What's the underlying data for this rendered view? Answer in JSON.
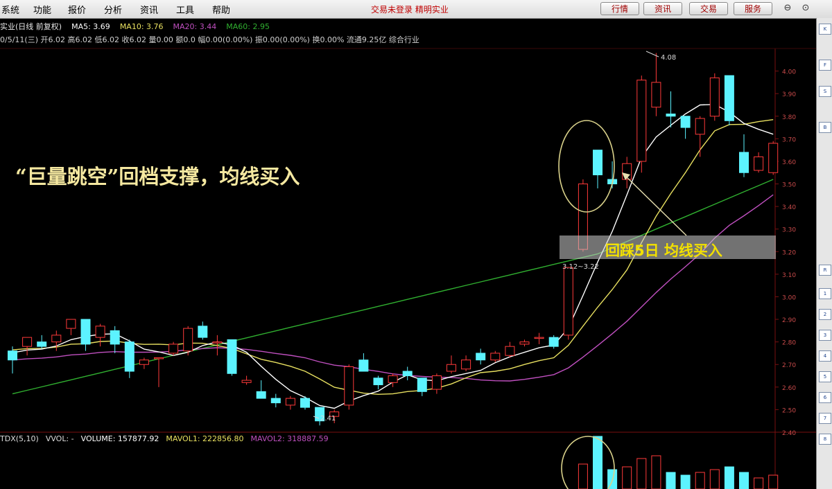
{
  "menubar": {
    "items": [
      "系统",
      "功能",
      "报价",
      "分析",
      "资讯",
      "工具",
      "帮助"
    ],
    "brand": "交易未登录  精明实业",
    "buttons": [
      "行情",
      "资讯",
      "交易",
      "服务"
    ],
    "window_controls": [
      "⊖",
      "⊙"
    ]
  },
  "info": {
    "title": "实业(日线 前复权)",
    "ma5": "MA5: 3.69",
    "ma10": "MA10: 3.76",
    "ma20": "MA20: 3.44",
    "ma60": "MA60: 2.95",
    "ohlc_line": "0/5/11(三) 开6.02 高6.02 低6.02 收6.02 量0.00 额0.0 幅0.00(0.00%) 振0.00(0.00%) 换0.00% 流通9.25亿 综合行业"
  },
  "colors": {
    "up": "#ff3a3a",
    "down": "#5cf3ff",
    "ma5": "#ffffff",
    "ma10": "#e8e060",
    "ma20": "#c050c0",
    "ma60": "#30b030",
    "annotation": "#f5e8a0",
    "highlight_text": "#f2e000"
  },
  "annotations": {
    "main_text": "“巨量跳空”回档支撑，均线买入",
    "callout": "回踩5日 均线买入",
    "gap_label": "3.12~3.22",
    "high_label": "4.08",
    "low_label": "2.41"
  },
  "volume_bar": {
    "indicator": "TDX(5,10)",
    "vvol": "VVOL: -",
    "volume": "VOLUME: 157877.92",
    "mavol1": "MAVOL1: 222856.80",
    "mavol2": "MAVOL2: 318887.59"
  },
  "rightbar_icons": [
    "K",
    "F",
    "S",
    "B",
    "R",
    "1",
    "2",
    "3",
    "4",
    "5",
    "6",
    "7",
    "8"
  ],
  "chart_data": {
    "type": "candlestick",
    "title": "",
    "ylim": [
      2.4,
      4.1
    ],
    "y_ticks": [
      4.0,
      3.9,
      3.8,
      3.7,
      3.6,
      3.5,
      3.4,
      3.3,
      3.2,
      3.1,
      3.0,
      2.9,
      2.8,
      2.7,
      2.6,
      2.5,
      2.4
    ],
    "candles": [
      {
        "o": 2.76,
        "h": 2.78,
        "l": 2.66,
        "c": 2.72
      },
      {
        "o": 2.78,
        "h": 2.82,
        "l": 2.74,
        "c": 2.82
      },
      {
        "o": 2.8,
        "h": 2.83,
        "l": 2.77,
        "c": 2.78
      },
      {
        "o": 2.8,
        "h": 2.85,
        "l": 2.76,
        "c": 2.83
      },
      {
        "o": 2.86,
        "h": 2.9,
        "l": 2.83,
        "c": 2.9
      },
      {
        "o": 2.9,
        "h": 2.9,
        "l": 2.76,
        "c": 2.79
      },
      {
        "o": 2.82,
        "h": 2.88,
        "l": 2.78,
        "c": 2.87
      },
      {
        "o": 2.85,
        "h": 2.87,
        "l": 2.75,
        "c": 2.79
      },
      {
        "o": 2.8,
        "h": 2.81,
        "l": 2.64,
        "c": 2.67
      },
      {
        "o": 2.7,
        "h": 2.73,
        "l": 2.68,
        "c": 2.72
      },
      {
        "o": 2.73,
        "h": 2.73,
        "l": 2.6,
        "c": 2.73
      },
      {
        "o": 2.75,
        "h": 2.8,
        "l": 2.74,
        "c": 2.79
      },
      {
        "o": 2.76,
        "h": 2.87,
        "l": 2.74,
        "c": 2.86
      },
      {
        "o": 2.87,
        "h": 2.89,
        "l": 2.81,
        "c": 2.82
      },
      {
        "o": 2.8,
        "h": 2.83,
        "l": 2.74,
        "c": 2.8
      },
      {
        "o": 2.81,
        "h": 2.81,
        "l": 2.65,
        "c": 2.66
      },
      {
        "o": 2.62,
        "h": 2.65,
        "l": 2.61,
        "c": 2.63
      },
      {
        "o": 2.58,
        "h": 2.63,
        "l": 2.55,
        "c": 2.55
      },
      {
        "o": 2.55,
        "h": 2.57,
        "l": 2.51,
        "c": 2.53
      },
      {
        "o": 2.52,
        "h": 2.56,
        "l": 2.5,
        "c": 2.55
      },
      {
        "o": 2.55,
        "h": 2.56,
        "l": 2.5,
        "c": 2.51
      },
      {
        "o": 2.51,
        "h": 2.51,
        "l": 2.43,
        "c": 2.45
      },
      {
        "o": 2.47,
        "h": 2.5,
        "l": 2.44,
        "c": 2.49
      },
      {
        "o": 2.52,
        "h": 2.7,
        "l": 2.5,
        "c": 2.69
      },
      {
        "o": 2.72,
        "h": 2.75,
        "l": 2.67,
        "c": 2.67
      },
      {
        "o": 2.64,
        "h": 2.65,
        "l": 2.59,
        "c": 2.61
      },
      {
        "o": 2.62,
        "h": 2.66,
        "l": 2.6,
        "c": 2.65
      },
      {
        "o": 2.67,
        "h": 2.69,
        "l": 2.63,
        "c": 2.65
      },
      {
        "o": 2.64,
        "h": 2.64,
        "l": 2.56,
        "c": 2.58
      },
      {
        "o": 2.59,
        "h": 2.66,
        "l": 2.57,
        "c": 2.65
      },
      {
        "o": 2.67,
        "h": 2.74,
        "l": 2.66,
        "c": 2.7
      },
      {
        "o": 2.68,
        "h": 2.74,
        "l": 2.67,
        "c": 2.72
      },
      {
        "o": 2.75,
        "h": 2.77,
        "l": 2.7,
        "c": 2.72
      },
      {
        "o": 2.72,
        "h": 2.76,
        "l": 2.71,
        "c": 2.75
      },
      {
        "o": 2.74,
        "h": 2.8,
        "l": 2.73,
        "c": 2.78
      },
      {
        "o": 2.79,
        "h": 2.81,
        "l": 2.78,
        "c": 2.8
      },
      {
        "o": 2.82,
        "h": 2.84,
        "l": 2.79,
        "c": 2.82
      },
      {
        "o": 2.82,
        "h": 2.83,
        "l": 2.77,
        "c": 2.78
      },
      {
        "o": 2.83,
        "h": 3.13,
        "l": 2.81,
        "c": 3.13
      },
      {
        "o": 3.21,
        "h": 3.52,
        "l": 3.2,
        "c": 3.5
      },
      {
        "o": 3.65,
        "h": 3.65,
        "l": 3.48,
        "c": 3.54
      },
      {
        "o": 3.52,
        "h": 3.6,
        "l": 3.48,
        "c": 3.5
      },
      {
        "o": 3.52,
        "h": 3.62,
        "l": 3.48,
        "c": 3.59
      },
      {
        "o": 3.6,
        "h": 3.98,
        "l": 3.55,
        "c": 3.96
      },
      {
        "o": 3.84,
        "h": 4.08,
        "l": 3.8,
        "c": 3.95
      },
      {
        "o": 3.81,
        "h": 3.91,
        "l": 3.75,
        "c": 3.8
      },
      {
        "o": 3.8,
        "h": 3.8,
        "l": 3.7,
        "c": 3.75
      },
      {
        "o": 3.72,
        "h": 3.8,
        "l": 3.62,
        "c": 3.79
      },
      {
        "o": 3.8,
        "h": 3.99,
        "l": 3.78,
        "c": 3.97
      },
      {
        "o": 3.98,
        "h": 3.98,
        "l": 3.76,
        "c": 3.78
      },
      {
        "o": 3.64,
        "h": 3.72,
        "l": 3.53,
        "c": 3.55
      },
      {
        "o": 3.56,
        "h": 3.64,
        "l": 3.55,
        "c": 3.62
      },
      {
        "o": 3.55,
        "h": 3.69,
        "l": 3.54,
        "c": 3.68
      }
    ]
  }
}
